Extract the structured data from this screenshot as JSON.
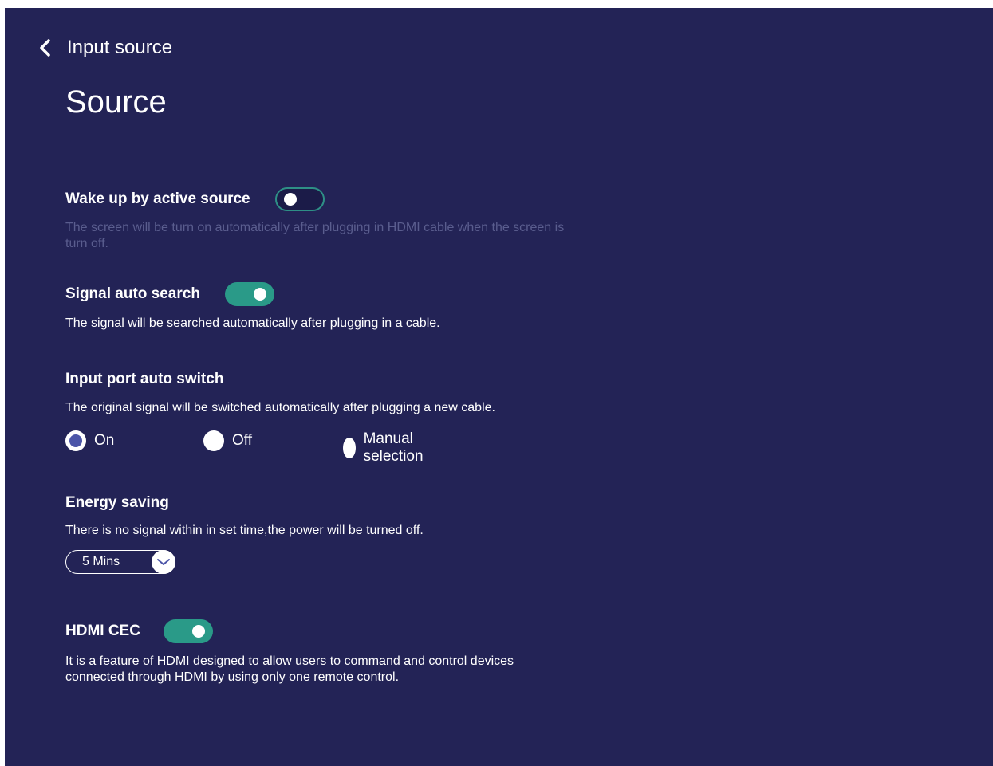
{
  "header": {
    "back_label": "Input source",
    "title": "Source"
  },
  "wake_up": {
    "title": "Wake up by active source",
    "description": "The screen will be turn on automatically after plugging in HDMI cable when the screen is turn off.",
    "toggle_state": "off"
  },
  "signal_auto_search": {
    "title": "Signal auto search",
    "description": "The signal will be searched automatically after plugging in a cable.",
    "toggle_state": "on"
  },
  "input_port_auto_switch": {
    "title": "Input port auto switch",
    "description": "The original signal will be switched automatically after plugging a new cable.",
    "options": [
      {
        "label": "On",
        "selected": true
      },
      {
        "label": "Off",
        "selected": false
      },
      {
        "label": "Manual selection",
        "selected": false
      }
    ]
  },
  "energy_saving": {
    "title": "Energy saving",
    "description": "There is no signal within in set time,the power will be turned off.",
    "selected_value": "5 Mins"
  },
  "hdmi_cec": {
    "title": "HDMI CEC",
    "description": "It is a feature of HDMI designed to allow users to command and control devices connected through HDMI by using only one remote control.",
    "toggle_state": "on"
  },
  "colors": {
    "background": "#232356",
    "toggle_on": "#2a9a88",
    "radio_selected": "#4c55a8",
    "dim_text": "#5a5d8e"
  },
  "icons": {
    "back": "chevron-left-icon",
    "dropdown": "chevron-down-icon"
  }
}
